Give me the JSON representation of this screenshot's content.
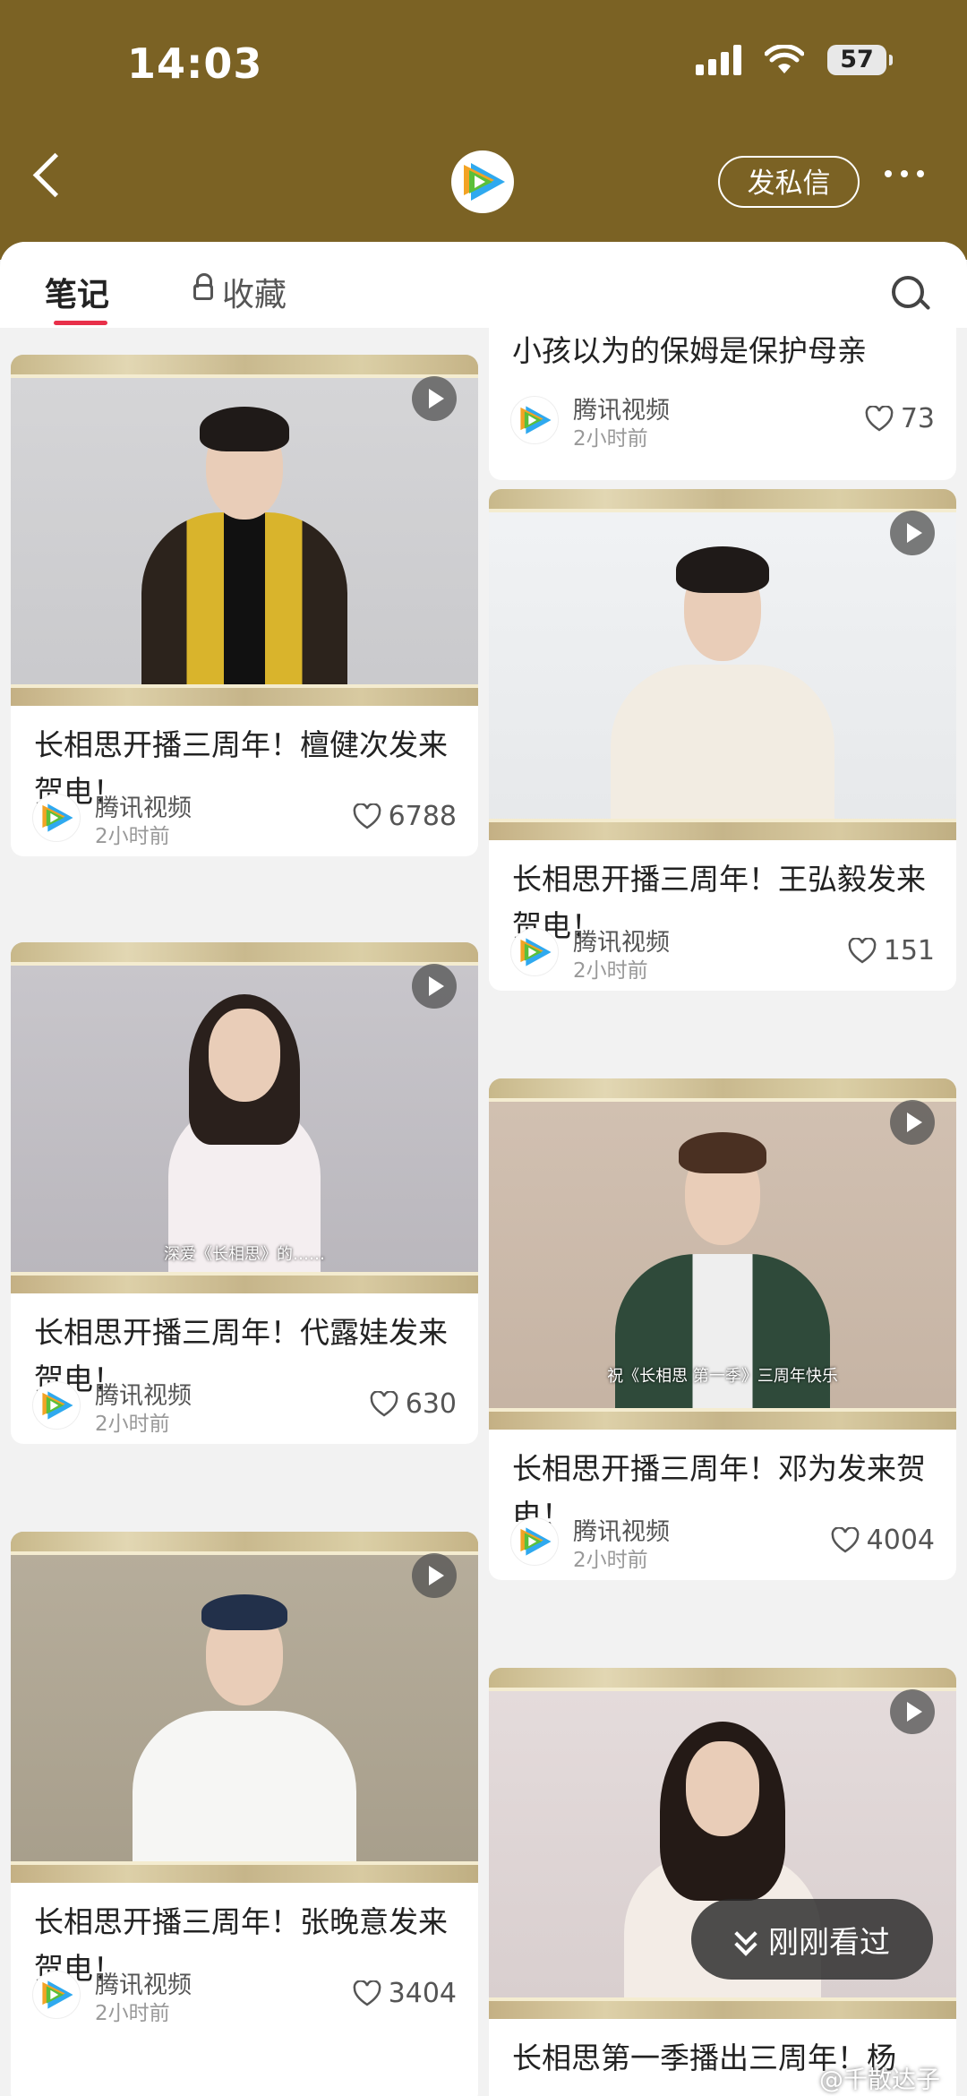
{
  "status": {
    "time": "14:03",
    "battery": "57"
  },
  "header": {
    "message_button": "发私信"
  },
  "tabs": {
    "notes": "笔记",
    "favorites": "收藏"
  },
  "left_column": [
    {
      "title": "长相思开播三周年！檀健次发来贺电！",
      "author": "腾讯视频",
      "time": "2小时前",
      "likes": "6788"
    },
    {
      "title": "长相思开播三周年！代露娃发来贺电！",
      "author": "腾讯视频",
      "time": "2小时前",
      "likes": "630",
      "video_caption": "深爱《长相思》的……"
    },
    {
      "title": "长相思开播三周年！张晚意发来贺电！",
      "author": "腾讯视频",
      "time": "2小时前",
      "likes": "3404"
    }
  ],
  "right_column": [
    {
      "title": "小孩以为的保姆是保护母亲",
      "author": "腾讯视频",
      "time": "2小时前",
      "likes": "73"
    },
    {
      "title": "长相思开播三周年！王弘毅发来贺电！",
      "author": "腾讯视频",
      "time": "2小时前",
      "likes": "151"
    },
    {
      "title": "长相思开播三周年！邓为发来贺电！",
      "author": "腾讯视频",
      "time": "2小时前",
      "likes": "4004",
      "video_caption": "祝《长相思 第一季》三周年快乐"
    },
    {
      "title": "长相思第一季播出三周年！杨",
      "author": "",
      "time": "",
      "likes": ""
    }
  ],
  "recent_button": "刚刚看过",
  "watermark": "@千散达子",
  "colors": {
    "header_bg": "#7b6224",
    "accent": "#e8304a"
  }
}
